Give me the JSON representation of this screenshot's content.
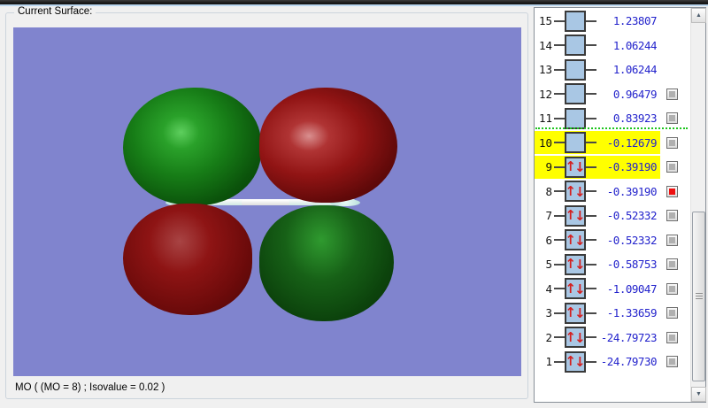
{
  "left_panel": {
    "title": "Current Surface:",
    "status_text": "MO ( (MO = 8) ; Isovalue = 0.02 )",
    "viewport": {
      "background_color": "#8084ce",
      "surface_type": "molecular orbital isosurface, four lobes",
      "positive_lobe_color": "#177d17",
      "negative_lobe_color": "#911414",
      "mo_number": 8,
      "isovalue": 0.02
    }
  },
  "mo_list": {
    "value_color": "#2323cc",
    "highlight_color": "#ffff00",
    "separator_color": "#1dc51d",
    "selected_checkbox_color": "#ee1010",
    "occupied_arrow_color": "#d42020",
    "orbital_box_color": "#a9c7e4",
    "arrow_up": "↑",
    "arrow_down": "↓",
    "scroll_up_glyph": "▲",
    "scroll_down_glyph": "▼",
    "rows": [
      {
        "index": 15,
        "energy": "1.23807",
        "occupied": false,
        "checkbox": "none",
        "highlight": false
      },
      {
        "index": 14,
        "energy": "1.06244",
        "occupied": false,
        "checkbox": "none",
        "highlight": false
      },
      {
        "index": 13,
        "energy": "1.06244",
        "occupied": false,
        "checkbox": "none",
        "highlight": false
      },
      {
        "index": 12,
        "energy": "0.96479",
        "occupied": false,
        "checkbox": "unchecked",
        "highlight": false
      },
      {
        "index": 11,
        "energy": "0.83923",
        "occupied": false,
        "checkbox": "unchecked",
        "highlight": false
      },
      {
        "index": 10,
        "energy": "-0.12679",
        "occupied": false,
        "checkbox": "unchecked",
        "highlight": true
      },
      {
        "index": 9,
        "energy": "-0.39190",
        "occupied": true,
        "checkbox": "unchecked",
        "highlight": true
      },
      {
        "index": 8,
        "energy": "-0.39190",
        "occupied": true,
        "checkbox": "checked-red",
        "highlight": false
      },
      {
        "index": 7,
        "energy": "-0.52332",
        "occupied": true,
        "checkbox": "unchecked",
        "highlight": false
      },
      {
        "index": 6,
        "energy": "-0.52332",
        "occupied": true,
        "checkbox": "unchecked",
        "highlight": false
      },
      {
        "index": 5,
        "energy": "-0.58753",
        "occupied": true,
        "checkbox": "unchecked",
        "highlight": false
      },
      {
        "index": 4,
        "energy": "-1.09047",
        "occupied": true,
        "checkbox": "unchecked",
        "highlight": false
      },
      {
        "index": 3,
        "energy": "-1.33659",
        "occupied": true,
        "checkbox": "unchecked",
        "highlight": false
      },
      {
        "index": 2,
        "energy": "-24.79723",
        "occupied": true,
        "checkbox": "unchecked",
        "highlight": false
      },
      {
        "index": 1,
        "energy": "-24.79730",
        "occupied": true,
        "checkbox": "unchecked",
        "highlight": false
      }
    ]
  }
}
